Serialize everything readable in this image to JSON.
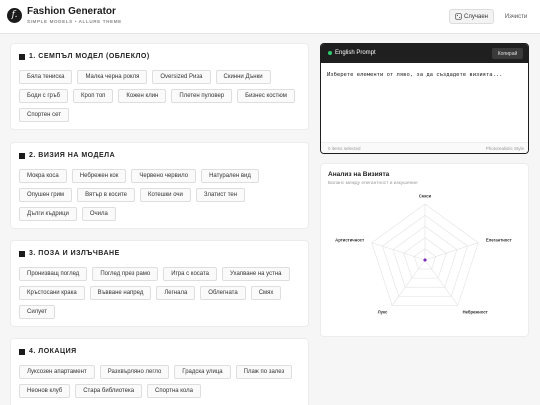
{
  "header": {
    "title": "Fashion Generator",
    "subtitle": "SIMPLE MODELS • ALLURE THEME",
    "logo_letter": "f.",
    "random_icon": "dice-icon",
    "random_label": "Случаен",
    "clear_label": "Изчисти"
  },
  "sections": [
    {
      "title": "1. СЕМПЪЛ МОДЕЛ (ОБЛЕКЛО)",
      "chips": [
        "Бяла тениска",
        "Малка черна рокля",
        "Oversized Риза",
        "Скинни Дънки",
        "Боди с гръб",
        "Кроп топ",
        "Кожен клин",
        "Плетен пуловер",
        "Бизнес костюм",
        "Спортен сет"
      ]
    },
    {
      "title": "2. ВИЗИЯ НА МОДЕЛА",
      "chips": [
        "Мокра коса",
        "Небрежен кок",
        "Червено червило",
        "Натурален вид",
        "Опушен грим",
        "Вятър в косите",
        "Котешки очи",
        "Златист тен",
        "Дълги къдрици",
        "Очила"
      ]
    },
    {
      "title": "3. ПОЗА И ИЗЛЪЧВАНЕ",
      "chips": [
        "Пронизващ поглед",
        "Поглед през рамо",
        "Игра с косата",
        "Ухапване на устна",
        "Кръстосани крака",
        "Въвване напред",
        "Легнала",
        "Облегната",
        "Смях",
        "Силует"
      ]
    },
    {
      "title": "4. ЛОКАЦИЯ",
      "chips": [
        "Луксозен апартамент",
        "Разхвърляно легло",
        "Градска улица",
        "Плаж по залез",
        "Неонов клуб",
        "Стара библиотека",
        "Спортна кола"
      ]
    }
  ],
  "prompt": {
    "title": "English Prompt",
    "copy_label": "Копирай",
    "placeholder": "Изберете елементи от ляво, за да създадете визията...",
    "items_selected": "0 items selected",
    "style": "Photorealistic Style"
  },
  "radar": {
    "title": "Анализ на Визията",
    "subtitle": "Баланс между елегантност и изкушение",
    "chart_data": {
      "type": "radar",
      "axes": [
        "Секси",
        "Елегантност",
        "Небрежност",
        "Лукс",
        "Артистичност"
      ],
      "values": [
        0,
        0,
        0,
        0,
        0
      ],
      "rings": 5,
      "point_color": "#7b2cbf"
    }
  }
}
